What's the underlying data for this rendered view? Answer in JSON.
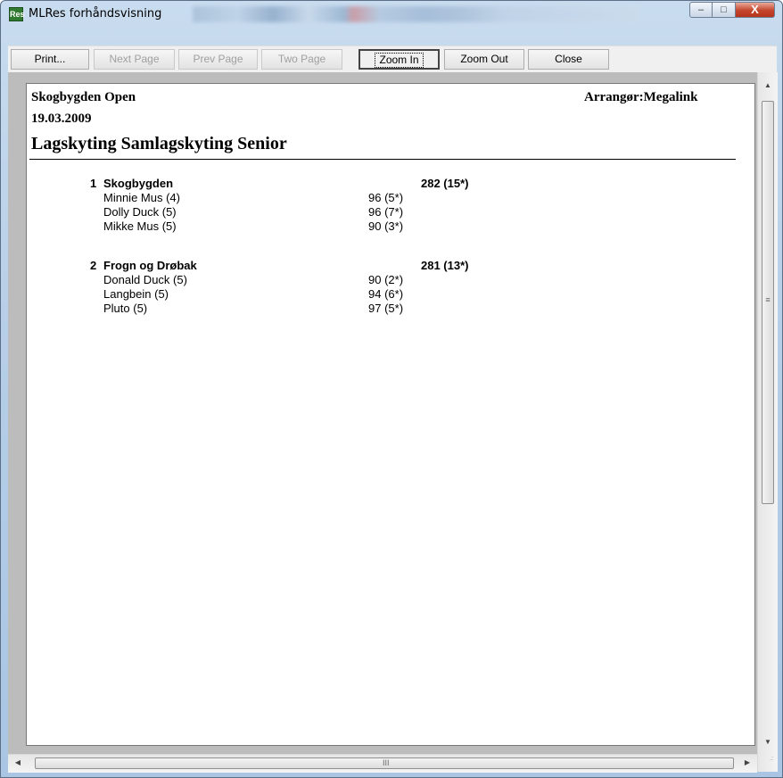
{
  "window": {
    "title": "MLRes forhåndsvisning",
    "app_icon_text": "Res",
    "caption_buttons": {
      "minimize": "–",
      "maximize": "□",
      "close": "X"
    }
  },
  "toolbar": {
    "print": "Print...",
    "next_page": "Next Page",
    "prev_page": "Prev Page",
    "two_page": "Two Page",
    "zoom_in": "Zoom In",
    "zoom_out": "Zoom Out",
    "close": "Close"
  },
  "report": {
    "event": "Skogbygden Open",
    "date": "19.03.2009",
    "organizer": "Arrangør:Megalink",
    "title": "Lagskyting Samlagskyting Senior",
    "teams": [
      {
        "rank": "1",
        "name": "Skogbygden",
        "total": "282 (15*)",
        "members": [
          {
            "name": "Minnie Mus (4)",
            "score": "96 (5*)"
          },
          {
            "name": "Dolly Duck (5)",
            "score": "96 (7*)"
          },
          {
            "name": "Mikke Mus (5)",
            "score": "90 (3*)"
          }
        ]
      },
      {
        "rank": "2",
        "name": "Frogn og Drøbak",
        "total": "281 (13*)",
        "members": [
          {
            "name": "Donald Duck (5)",
            "score": "90 (2*)"
          },
          {
            "name": "Langbein (5)",
            "score": "94 (6*)"
          },
          {
            "name": "Pluto (5)",
            "score": "97 (5*)"
          }
        ]
      }
    ]
  },
  "scrollbars": {
    "up": "▲",
    "down": "▼",
    "left": "◀",
    "right": "▶",
    "v_grip": "≡",
    "h_grip": "III"
  }
}
